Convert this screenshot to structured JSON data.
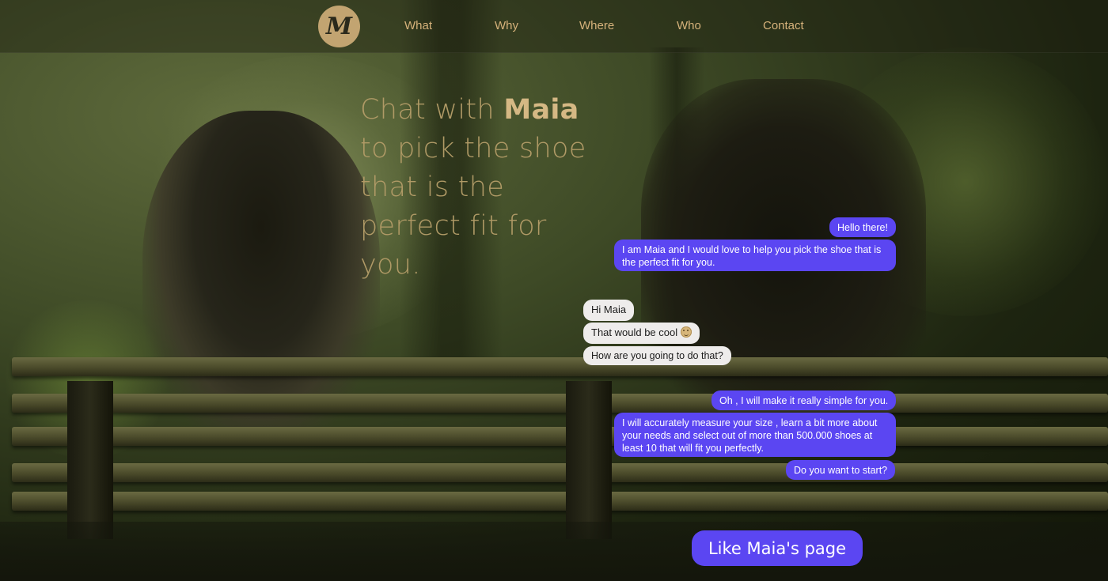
{
  "nav": {
    "logo_letter": "M",
    "links": [
      "What",
      "Why",
      "Where",
      "Who",
      "Contact"
    ]
  },
  "hero": {
    "line1_prefix": "Chat with",
    "line1_name": "Maia",
    "line2": "to pick the shoe",
    "line3": "that is the",
    "line4": "perfect fit for",
    "line5": "you."
  },
  "chat": {
    "messages": [
      {
        "from": "bot",
        "text": "Hello there!"
      },
      {
        "from": "bot",
        "text": "I am Maia and I would love to help you pick the shoe that is the perfect fit for you."
      },
      {
        "from": "user",
        "text": "Hi Maia"
      },
      {
        "from": "user",
        "text": "That would be cool",
        "emoji": "smiling-face-icon"
      },
      {
        "from": "user",
        "text": "How are you going to do that?"
      },
      {
        "from": "bot",
        "text": "Oh , I will make it really simple for you."
      },
      {
        "from": "bot",
        "text": "I will accurately measure your size , learn a bit more about your needs and select out of more than 500.000 shoes at least 10 that will fit you perfectly."
      },
      {
        "from": "bot",
        "text": "Do you want to start?"
      }
    ]
  },
  "cta": {
    "label": "Like Maia's page"
  },
  "colors": {
    "accent": "#5b46f2",
    "gold": "#c2a471",
    "nav_text": "#d6b27b",
    "user_bubble": "#eeeceb"
  }
}
